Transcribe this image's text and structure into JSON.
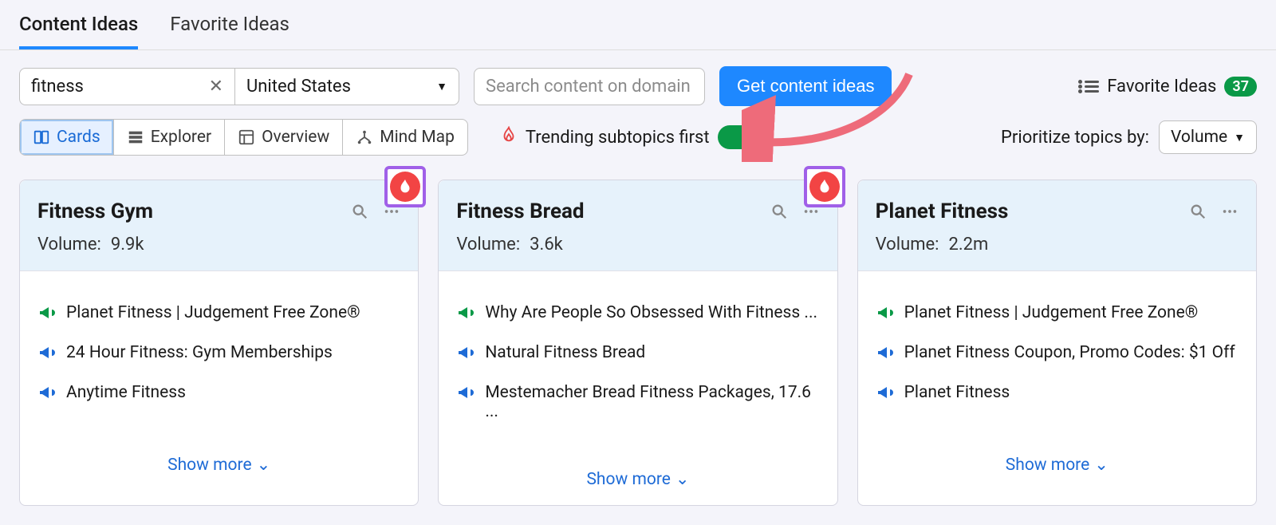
{
  "tabs": {
    "content_ideas": "Content Ideas",
    "favorite_ideas": "Favorite Ideas"
  },
  "toolbar": {
    "keyword_value": "fitness",
    "country_value": "United States",
    "domain_placeholder": "Search content on domain",
    "get_ideas_label": "Get content ideas",
    "favorite_link": "Favorite Ideas",
    "favorite_count": "37"
  },
  "views": {
    "cards": "Cards",
    "explorer": "Explorer",
    "overview": "Overview",
    "mindmap": "Mind Map"
  },
  "trending": {
    "label": "Trending subtopics first"
  },
  "prioritize": {
    "label": "Prioritize topics by:",
    "value": "Volume"
  },
  "cards": [
    {
      "title": "Fitness Gym",
      "volume_label": "Volume:",
      "volume_value": "9.9k",
      "trending": true,
      "items": [
        {
          "color": "green",
          "text": "Planet Fitness | Judgement Free Zone®"
        },
        {
          "color": "blue",
          "text": "24 Hour Fitness: Gym Memberships"
        },
        {
          "color": "blue",
          "text": "Anytime Fitness"
        }
      ],
      "show_more": "Show more"
    },
    {
      "title": "Fitness Bread",
      "volume_label": "Volume:",
      "volume_value": "3.6k",
      "trending": true,
      "items": [
        {
          "color": "green",
          "text": "Why Are People So Obsessed With Fitness ..."
        },
        {
          "color": "blue",
          "text": "Natural Fitness Bread"
        },
        {
          "color": "blue",
          "text": "Mestemacher Bread Fitness Packages, 17.6 ..."
        }
      ],
      "show_more": "Show more"
    },
    {
      "title": "Planet Fitness",
      "volume_label": "Volume:",
      "volume_value": "2.2m",
      "trending": false,
      "items": [
        {
          "color": "green",
          "text": "Planet Fitness | Judgement Free Zone®"
        },
        {
          "color": "blue",
          "text": "Planet Fitness Coupon, Promo Codes: $1 Off"
        },
        {
          "color": "blue",
          "text": "Planet Fitness"
        }
      ],
      "show_more": "Show more"
    }
  ]
}
